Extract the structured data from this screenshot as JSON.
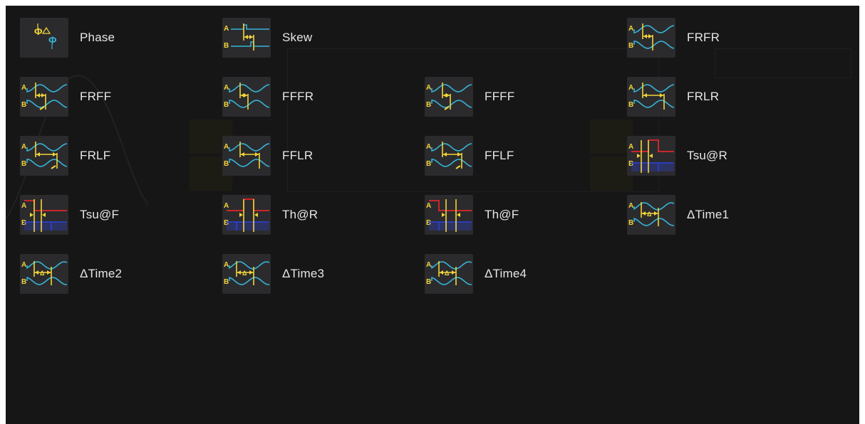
{
  "items": [
    {
      "label": "Phase",
      "icon": "phase-icon"
    },
    {
      "label": "Skew",
      "icon": "skew-icon"
    },
    {
      "label": "FRFR",
      "icon": "frfr-icon"
    },
    {
      "label": "FRFF",
      "icon": "frff-icon"
    },
    {
      "label": "FFFR",
      "icon": "fffr-icon"
    },
    {
      "label": "FFFF",
      "icon": "ffff-icon"
    },
    {
      "label": "FRLR",
      "icon": "frlr-icon"
    },
    {
      "label": "FRLF",
      "icon": "frlf-icon"
    },
    {
      "label": "FFLR",
      "icon": "fflr-icon"
    },
    {
      "label": "FFLF",
      "icon": "fflf-icon"
    },
    {
      "label": "Tsu@R",
      "icon": "setup-rise-icon"
    },
    {
      "label": "Tsu@F",
      "icon": "setup-fall-icon"
    },
    {
      "label": "Th@R",
      "icon": "hold-rise-icon"
    },
    {
      "label": "Th@F",
      "icon": "hold-fall-icon"
    },
    {
      "label": "ΔTime1",
      "icon": "delta-time-icon"
    },
    {
      "label": "ΔTime2",
      "icon": "delta-time-icon"
    },
    {
      "label": "ΔTime3",
      "icon": "delta-time-icon"
    },
    {
      "label": "ΔTime4",
      "icon": "delta-time-icon"
    }
  ],
  "icon_text": {
    "a": "A",
    "b": "B",
    "delta": "Δ"
  },
  "colors": {
    "background": "#161617",
    "tile": "#2b2b2d",
    "label": "#e6e6e6",
    "yellow": "#f2d43a",
    "cyan": "#36b3d6",
    "red": "#e0262a",
    "blue": "#2d3fc7"
  }
}
